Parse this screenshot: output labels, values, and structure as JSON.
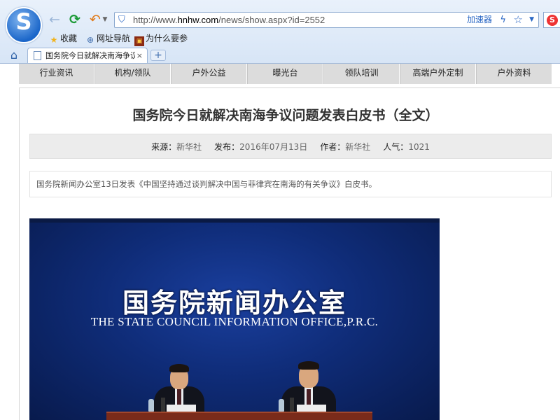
{
  "browser": {
    "url_prefix": "http://www.",
    "url_domain": "hnhw.com",
    "url_path": "/news/show.aspx?id=2552",
    "accelerator_label": "加速器",
    "bookmarks": [
      {
        "label": "收藏",
        "icon": "star-icon"
      },
      {
        "label": "网址导航",
        "icon": "globe-icon"
      },
      {
        "label": "为什么要参",
        "icon": "site-favicon"
      }
    ],
    "tab": {
      "title": "国务院今日就解决南海争议问题发表白皮书",
      "close": "×"
    },
    "new_tab": "+"
  },
  "nav": {
    "items": [
      "行业资讯",
      "机构/领队",
      "户外公益",
      "曝光台",
      "领队培训",
      "高端户外定制",
      "户外资料"
    ]
  },
  "article": {
    "title": "国务院今日就解决南海争议问题发表白皮书（全文）",
    "meta": {
      "source_label": "来源：",
      "source": "新华社",
      "published_label": "发布：",
      "published": "2016年07月13日",
      "author_label": "作者：",
      "author": "新华社",
      "views_label": "人气：",
      "views": "1021"
    },
    "summary": "国务院新闻办公室13日发表《中国坚持通过谈判解决中国与菲律宾在南海的有关争议》白皮书。",
    "photo": {
      "backdrop_cn": "国务院新闻办公室",
      "backdrop_en": "THE STATE COUNCIL INFORMATION OFFICE,P.R.C."
    }
  },
  "colors": {
    "chrome_bg": "#dbe7f6",
    "nav_bg": "#dcdcdc",
    "meta_bg": "#ececec",
    "photo_bg": "#0f2c78",
    "link_blue": "#2a67c4"
  }
}
